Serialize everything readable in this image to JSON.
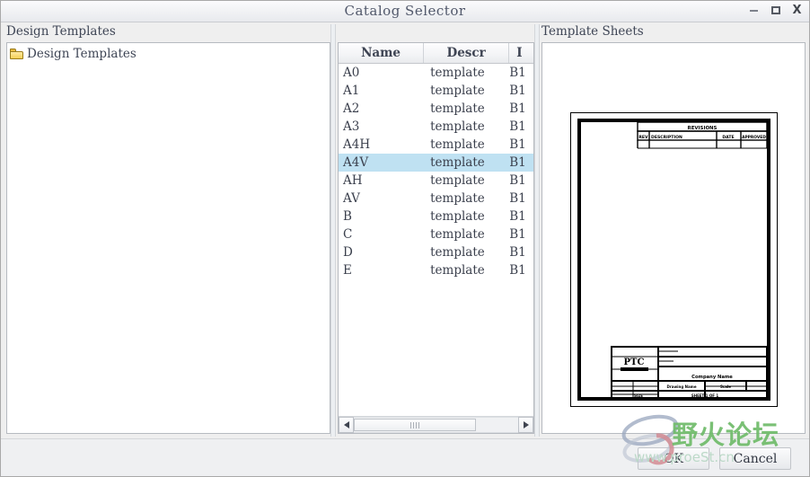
{
  "window": {
    "title": "Catalog Selector",
    "controls": {
      "minimize": "minimize-icon",
      "maximize": "maximize-icon",
      "close": "X"
    }
  },
  "tree_panel": {
    "label": "Design Templates",
    "root_item": "Design Templates",
    "icon": "folder-icon"
  },
  "list_panel": {
    "columns": [
      "Name",
      "Descr",
      "I"
    ],
    "rows": [
      {
        "name": "A0",
        "descr": "template",
        "id": "B1",
        "selected": false
      },
      {
        "name": "A1",
        "descr": "template",
        "id": "B1",
        "selected": false
      },
      {
        "name": "A2",
        "descr": "template",
        "id": "B1",
        "selected": false
      },
      {
        "name": "A3",
        "descr": "template",
        "id": "B1",
        "selected": false
      },
      {
        "name": "A4H",
        "descr": "template",
        "id": "B1",
        "selected": false
      },
      {
        "name": "A4V",
        "descr": "template",
        "id": "B1",
        "selected": true
      },
      {
        "name": "AH",
        "descr": "template",
        "id": "B1",
        "selected": false
      },
      {
        "name": "AV",
        "descr": "template",
        "id": "B1",
        "selected": false
      },
      {
        "name": "B",
        "descr": "template",
        "id": "B1",
        "selected": false
      },
      {
        "name": "C",
        "descr": "template",
        "id": "B1",
        "selected": false
      },
      {
        "name": "D",
        "descr": "template",
        "id": "B1",
        "selected": false
      },
      {
        "name": "E",
        "descr": "template",
        "id": "B1",
        "selected": false
      }
    ],
    "scrollbar": {
      "left_arrow": "scroll-left-icon",
      "right_arrow": "scroll-right-icon"
    }
  },
  "preview_panel": {
    "label": "Template Sheets",
    "sheet": {
      "revisions_title": "REVISIONS",
      "revisions_columns": [
        "REV",
        "DESCRIPTION",
        "DATE",
        "APPROVED"
      ],
      "logo": "PTC",
      "title_block_company": "Company Name",
      "title_block_fields": [
        "Drawing Name",
        "Scale",
        "Sheet"
      ]
    }
  },
  "footer": {
    "ok_label": "OK",
    "cancel_label": "Cancel"
  },
  "watermark": {
    "text": "野火论坛",
    "url": "www.proeSt.cn",
    "color": "#6fbb6a"
  }
}
